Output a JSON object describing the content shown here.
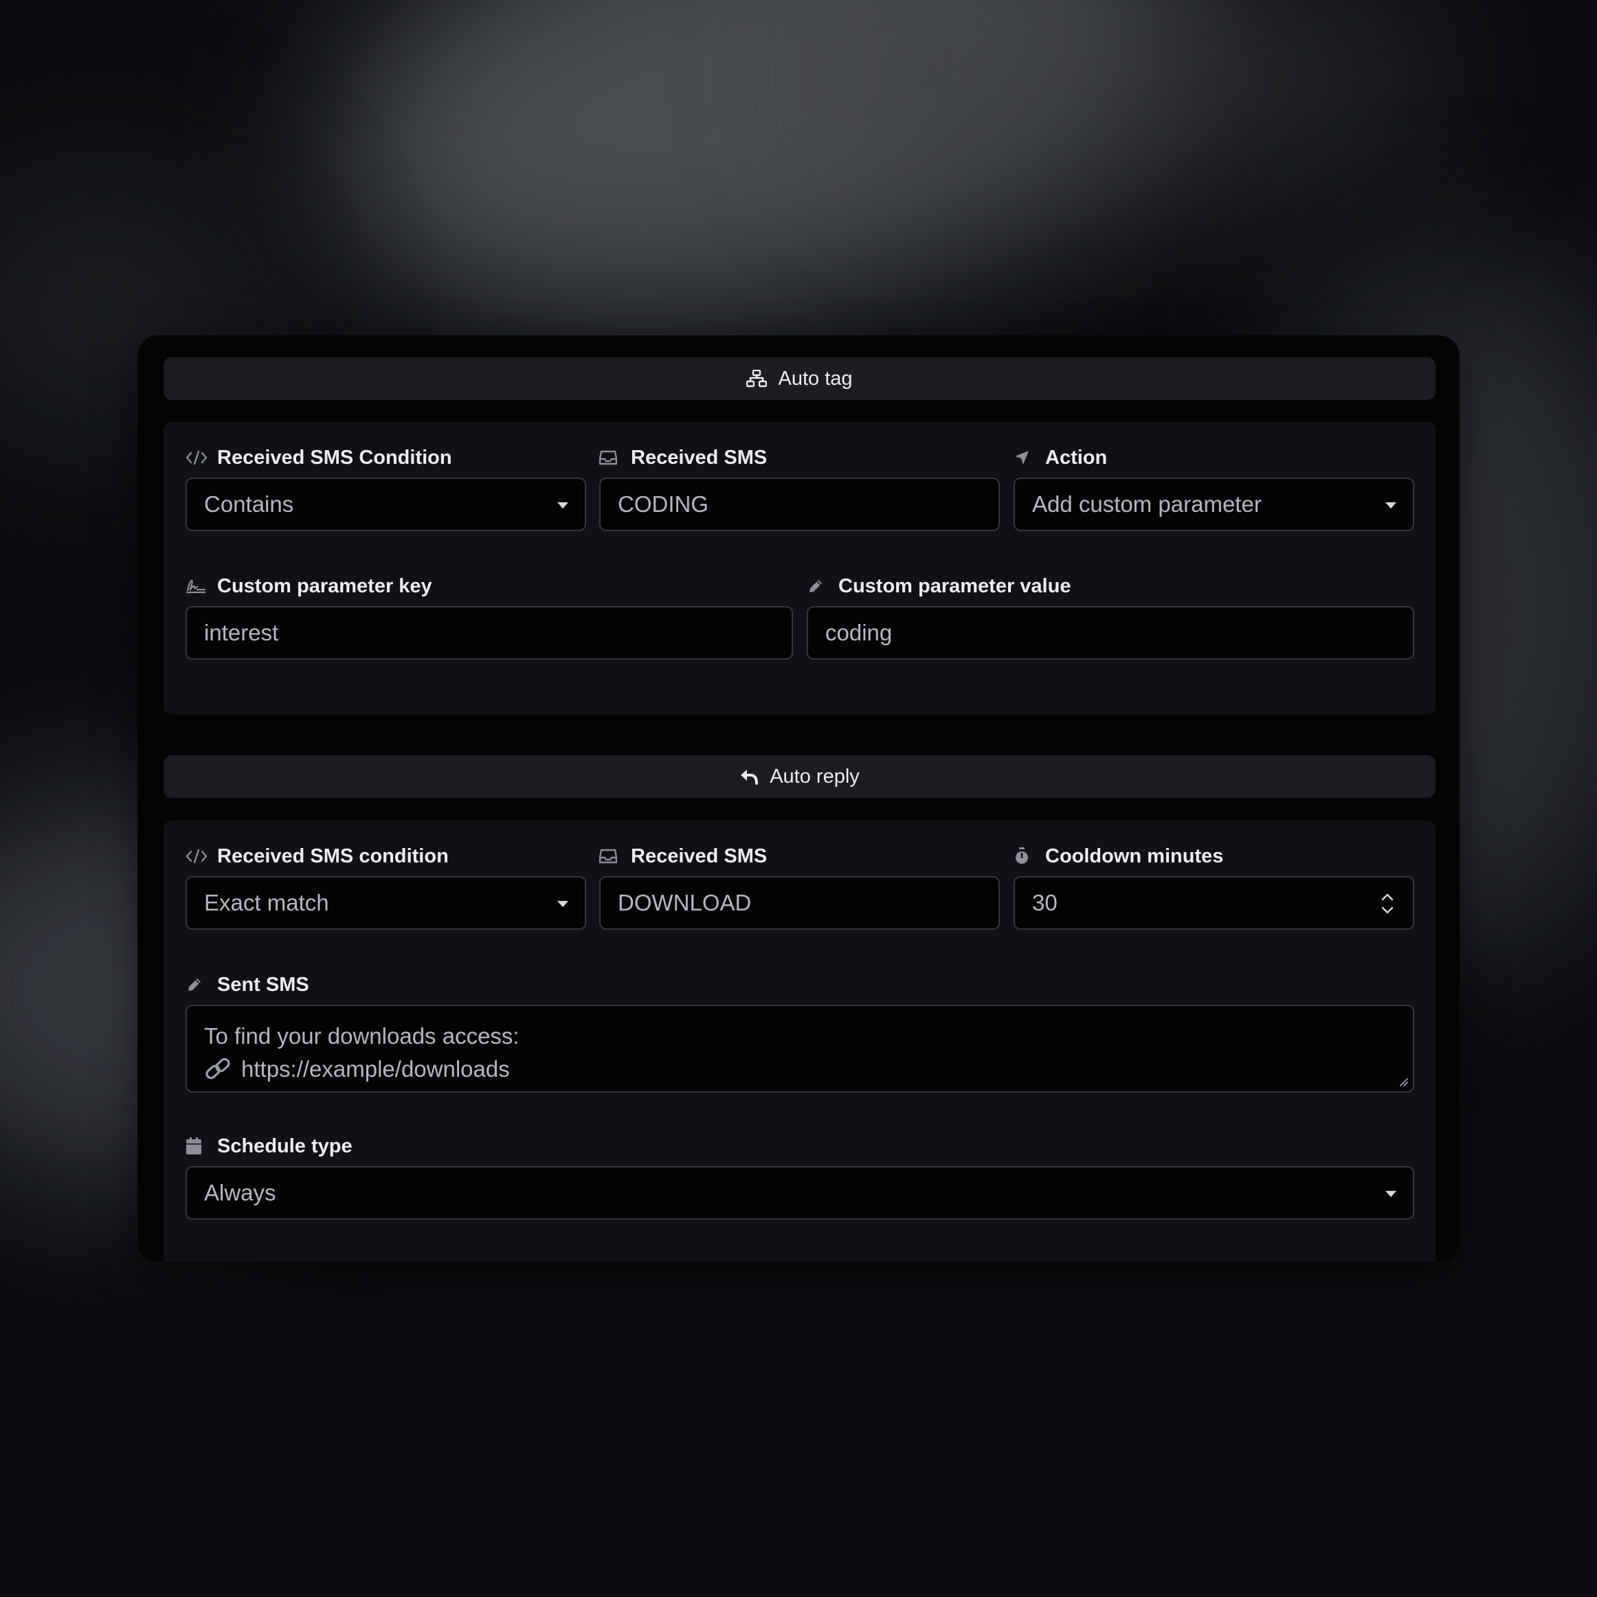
{
  "auto_tag": {
    "header_label": "Auto tag",
    "condition_label": "Received SMS Condition",
    "condition_value": "Contains",
    "received_label": "Received SMS",
    "received_value": "CODING",
    "action_label": "Action",
    "action_value": "Add custom parameter",
    "param_key_label": "Custom parameter key",
    "param_key_value": "interest",
    "param_value_label": "Custom parameter value",
    "param_value_value": "coding"
  },
  "auto_reply": {
    "header_label": "Auto reply",
    "condition_label": "Received SMS condition",
    "condition_value": "Exact match",
    "received_label": "Received SMS",
    "received_value": "DOWNLOAD",
    "cooldown_label": "Cooldown minutes",
    "cooldown_value": "30",
    "sent_label": "Sent SMS",
    "sent_line1": "To find your downloads access:",
    "sent_line2": "https://example/downloads",
    "schedule_label": "Schedule type",
    "schedule_value": "Always"
  },
  "icons": {
    "auto_tag": "sitemap-icon",
    "auto_reply": "reply-icon",
    "condition": "code-icon",
    "received_sms": "inbox-icon",
    "action": "location-arrow-icon",
    "param_key": "signature-icon",
    "param_value": "pencil-icon",
    "cooldown": "stopwatch-icon",
    "sent_sms": "pencil-icon",
    "schedule": "calendar-icon",
    "link_emoji": "link-icon"
  }
}
